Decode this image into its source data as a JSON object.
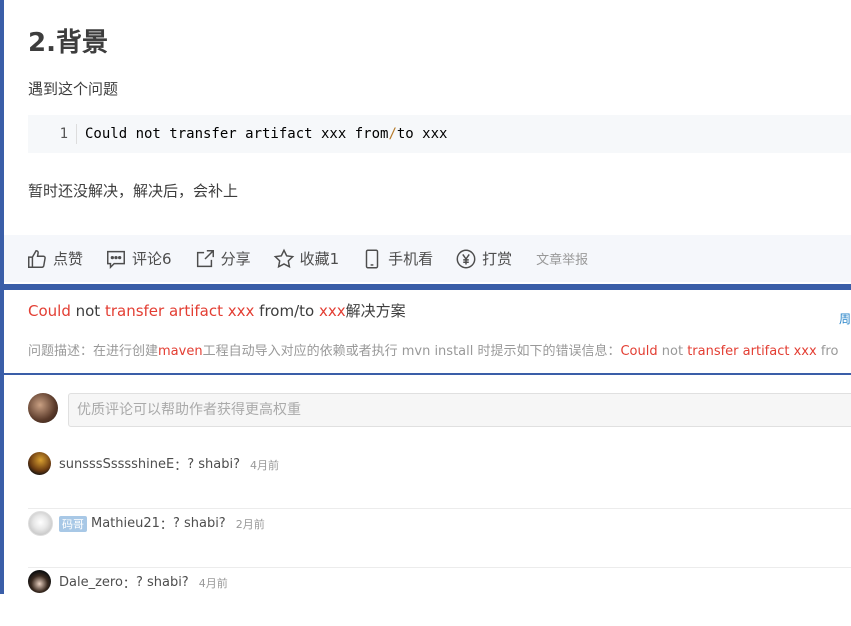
{
  "article": {
    "heading": "2.背景",
    "para1": "遇到这个问题",
    "code": {
      "line_no": "1",
      "before": "Could not transfer artifact xxx from",
      "slash": "/",
      "after": "to xxx"
    },
    "para2": "暂时还没解决，解决后，会补上"
  },
  "toolbar": {
    "like": "点赞",
    "comment": "评论6",
    "share": "分享",
    "favorite": "收藏1",
    "mobile": "手机看",
    "reward": "打赏",
    "report": "文章举报"
  },
  "recommend": {
    "title_parts": [
      {
        "text": "Could",
        "red": true
      },
      {
        "text": " not ",
        "red": false
      },
      {
        "text": "transfer artifact xxx",
        "red": true
      },
      {
        "text": " from/to ",
        "red": false
      },
      {
        "text": "xxx",
        "red": true
      },
      {
        "text": "解决方案",
        "red": false
      }
    ],
    "side": "周",
    "desc_parts": [
      {
        "text": "问题描述：在进行创建",
        "red": false
      },
      {
        "text": "maven",
        "red": true
      },
      {
        "text": "工程自动导入对应的依赖或者执行 mvn install 时提示如下的错误信息：",
        "red": false
      },
      {
        "text": "Could",
        "red": true
      },
      {
        "text": " not ",
        "red": false
      },
      {
        "text": "transfer artifact xxx",
        "red": true
      },
      {
        "text": " fro",
        "red": false
      }
    ]
  },
  "comment_box": {
    "placeholder": "优质评论可以帮助作者获得更高权重"
  },
  "comments": [
    {
      "user": "sunsssSsssshineE",
      "sep": "：",
      "text": "? shabi?",
      "time": "4月前",
      "badge": ""
    },
    {
      "user": "Mathieu21",
      "sep": "：",
      "text": "? shabi?",
      "time": "2月前",
      "badge": "码哥"
    },
    {
      "user": "Dale_zero",
      "sep": "：",
      "text": "? shabi?",
      "time": "4月前",
      "badge": ""
    }
  ],
  "colors": {
    "accent": "#3a5ea8",
    "keyword": "#e33e33",
    "toolbar_bg": "#f5f7fb"
  }
}
